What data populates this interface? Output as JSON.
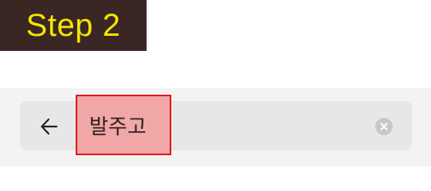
{
  "badge": {
    "label": "Step 2",
    "background": "#3a2724",
    "text_color": "#f7e400"
  },
  "search": {
    "query": "발주고",
    "back_icon": "arrow-left-icon",
    "clear_icon": "clear-circle-icon",
    "highlight_fill": "#f1a7a5",
    "highlight_border": "#e3151b"
  }
}
